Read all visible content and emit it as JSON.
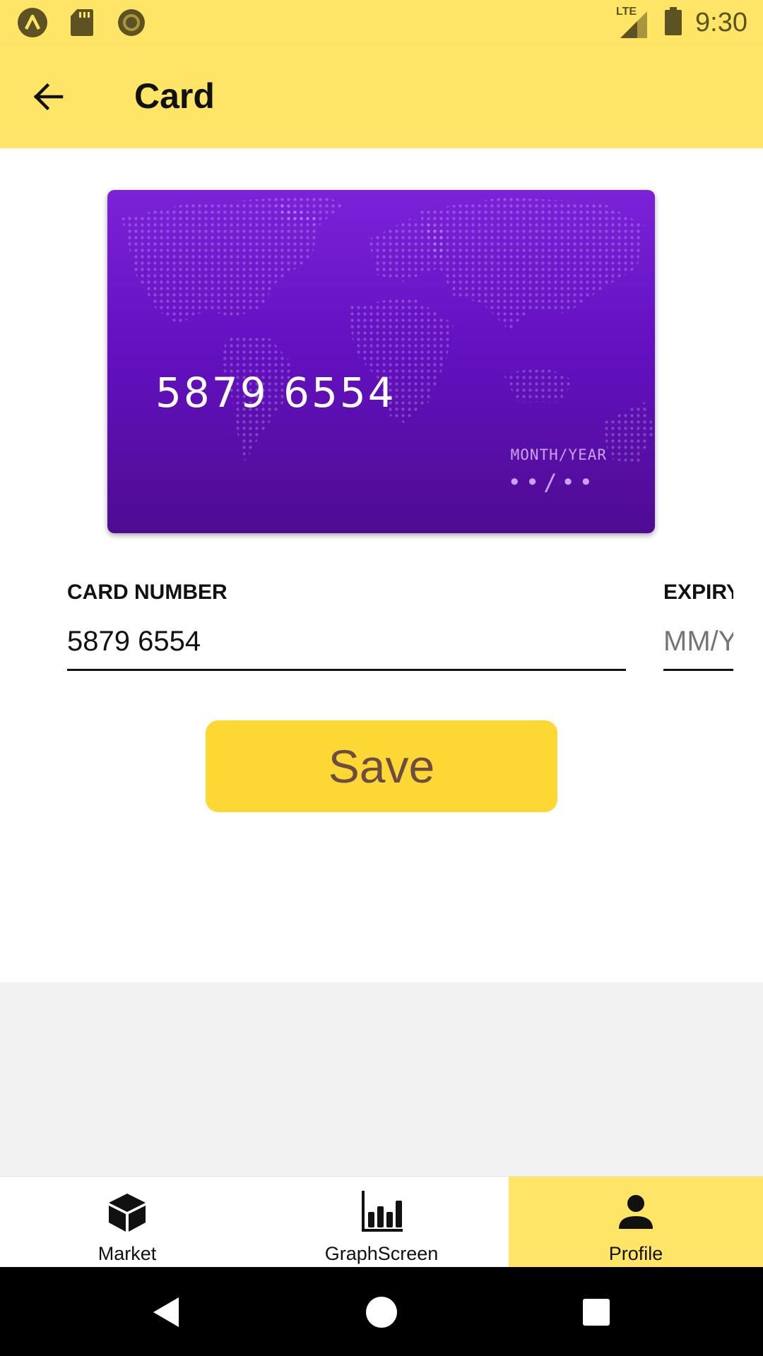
{
  "status_bar": {
    "time": "9:30",
    "network": "LTE",
    "icons": [
      "app-notification-icon",
      "sd-card-icon",
      "record-icon",
      "lte-signal-icon",
      "battery-icon"
    ]
  },
  "app_bar": {
    "title": "Card",
    "back_icon": "arrow-back-icon"
  },
  "card_preview": {
    "number": "5879  6554",
    "expiry_label": "MONTH/YEAR",
    "expiry_value": "••/••",
    "background_colors": [
      "#7b22d8",
      "#4e0c92"
    ]
  },
  "form": {
    "card_number": {
      "label": "CARD NUMBER",
      "value": "5879 6554"
    },
    "expiry": {
      "label": "EXPIRY",
      "placeholder": "MM/YY"
    }
  },
  "save_button": {
    "label": "Save",
    "color": "#fdd835"
  },
  "bottom_nav": {
    "tabs": [
      {
        "label": "Market",
        "icon": "cube-icon"
      },
      {
        "label": "GraphScreen",
        "icon": "bar-chart-icon"
      },
      {
        "label": "Profile",
        "icon": "person-icon",
        "active": true
      }
    ],
    "active_color": "#ffe566"
  },
  "system_nav": {
    "buttons": [
      "back-triangle-icon",
      "home-circle-icon",
      "recents-square-icon"
    ]
  }
}
